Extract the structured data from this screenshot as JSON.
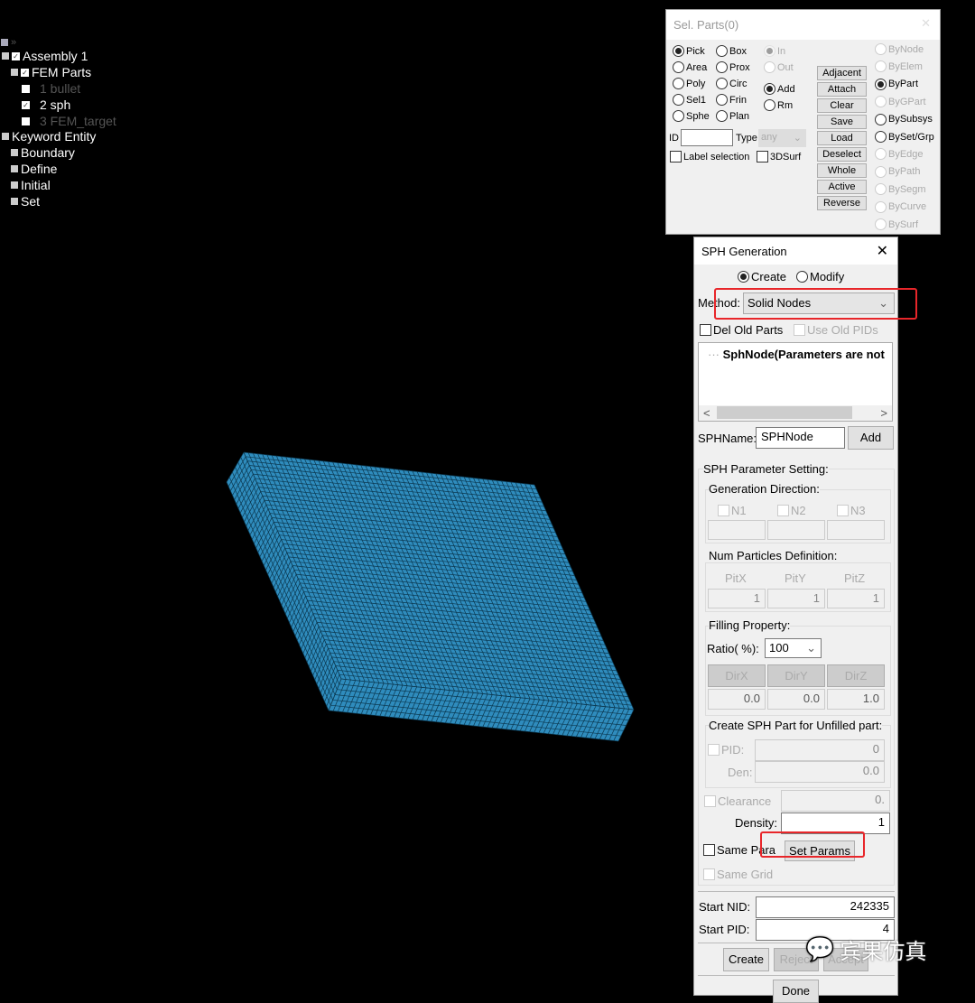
{
  "tree": {
    "assembly": "Assembly 1",
    "fem_parts": "FEM Parts",
    "parts": [
      {
        "label": "1 bullet",
        "checked": false,
        "visible": false
      },
      {
        "label": "2 sph",
        "checked": true,
        "visible": true
      },
      {
        "label": "3 FEM_target",
        "checked": false,
        "visible": false
      }
    ],
    "keyword_entity": "Keyword Entity",
    "keywords": [
      "Boundary",
      "Define",
      "Initial",
      "Set"
    ]
  },
  "sel_parts": {
    "title": "Sel. Parts(0)",
    "modes": [
      "Pick",
      "Box",
      "Area",
      "Prox",
      "Poly",
      "Circ",
      "Sel1",
      "Frin",
      "Sphe",
      "Plan"
    ],
    "selected_mode": "Pick",
    "in_out": [
      "In",
      "Out"
    ],
    "add_rm": [
      "Add",
      "Rm"
    ],
    "selected_add_rm": "Add",
    "buttons": [
      "Adjacent",
      "Attach",
      "Clear",
      "Save",
      "Load",
      "Deselect",
      "Whole",
      "Active",
      "Reverse"
    ],
    "by_options": [
      "ByNode",
      "ByElem",
      "ByPart",
      "ByGPart",
      "BySubsys",
      "BySet/Grp",
      "ByEdge",
      "ByPath",
      "BySegm",
      "ByCurve",
      "BySurf"
    ],
    "selected_by": "ByPart",
    "id_label": "ID",
    "id_value": "",
    "type_label": "Type",
    "type_value": "any",
    "label_selection": "Label selection",
    "surf3d": "3DSurf"
  },
  "sph": {
    "title": "SPH Generation",
    "create": "Create",
    "modify": "Modify",
    "mode": "Create",
    "method_label": "Method:",
    "method_value": "Solid Nodes",
    "del_old_parts": "Del Old Parts",
    "use_old_pids": "Use Old PIDs",
    "list_item": "SphNode(Parameters are not",
    "sphname_label": "SPHName:",
    "sphname_value": "SPHNode",
    "add": "Add",
    "param_setting": "SPH Parameter Setting:",
    "gen_direction": "Generation Direction:",
    "n_labels": [
      "N1",
      "N2",
      "N3"
    ],
    "num_particles": "Num Particles Definition:",
    "pit_labels": [
      "PitX",
      "PitY",
      "PitZ"
    ],
    "pit_values": [
      "1",
      "1",
      "1"
    ],
    "filling": "Filling Property:",
    "ratio_label": "Ratio( %):",
    "ratio_value": "100",
    "dir_labels": [
      "DirX",
      "DirY",
      "DirZ"
    ],
    "dir_values": [
      "0.0",
      "0.0",
      "1.0"
    ],
    "unfilled": "Create SPH Part for Unfilled part:",
    "pid_label": "PID:",
    "pid_value": "0",
    "den_label": "Den:",
    "den_value": "0.0",
    "clearance": "Clearance",
    "clearance_value": "0.",
    "density_label": "Density:",
    "density_value": "1",
    "same_para": "Same Para",
    "set_params": "Set Params",
    "same_grid": "Same Grid",
    "start_nid_label": "Start NID:",
    "start_nid": "242335",
    "start_pid_label": "Start PID:",
    "start_pid": "4",
    "create_btn": "Create",
    "reject": "Reject",
    "accept": "Accept",
    "done": "Done"
  },
  "watermark": "宾果仿真",
  "colors": {
    "mesh": "#2f8cbd",
    "mesh_line": "#0b3850",
    "highlight": "#e8262a"
  }
}
